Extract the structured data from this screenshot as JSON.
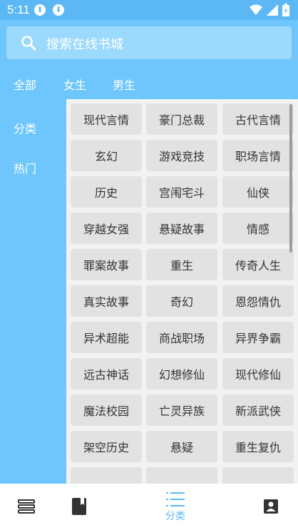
{
  "status_bar": {
    "time": "5:11"
  },
  "search": {
    "placeholder": "搜索在线书城"
  },
  "tabs": [
    {
      "label": "全部"
    },
    {
      "label": "女生"
    },
    {
      "label": "男生"
    }
  ],
  "sidebar": {
    "items": [
      {
        "label": "分类"
      },
      {
        "label": "热门"
      }
    ]
  },
  "categories": [
    "现代言情",
    "豪门总裁",
    "古代言情",
    "玄幻",
    "游戏竞技",
    "职场言情",
    "历史",
    "宫闱宅斗",
    "仙侠",
    "穿越女强",
    "悬疑故事",
    "情感",
    "罪案故事",
    "重生",
    "传奇人生",
    "真实故事",
    "奇幻",
    "恩怨情仇",
    "异术超能",
    "商战职场",
    "异界争霸",
    "远古神话",
    "幻想修仙",
    "现代修仙",
    "魔法校园",
    "亡灵异族",
    "新派武侠",
    "架空历史",
    "悬疑",
    "重生复仇"
  ],
  "bottom_nav": {
    "items": [
      {
        "icon": "bookshelf-icon",
        "label": ""
      },
      {
        "icon": "book-icon",
        "label": ""
      },
      {
        "icon": "list-icon",
        "label": "分类"
      },
      {
        "icon": "profile-icon",
        "label": ""
      }
    ]
  },
  "colors": {
    "primary": "#6EC6FC",
    "status_bar": "#5BB8F5",
    "active_nav": "#5BB8F5",
    "cell_bg": "#E2E2E2"
  }
}
